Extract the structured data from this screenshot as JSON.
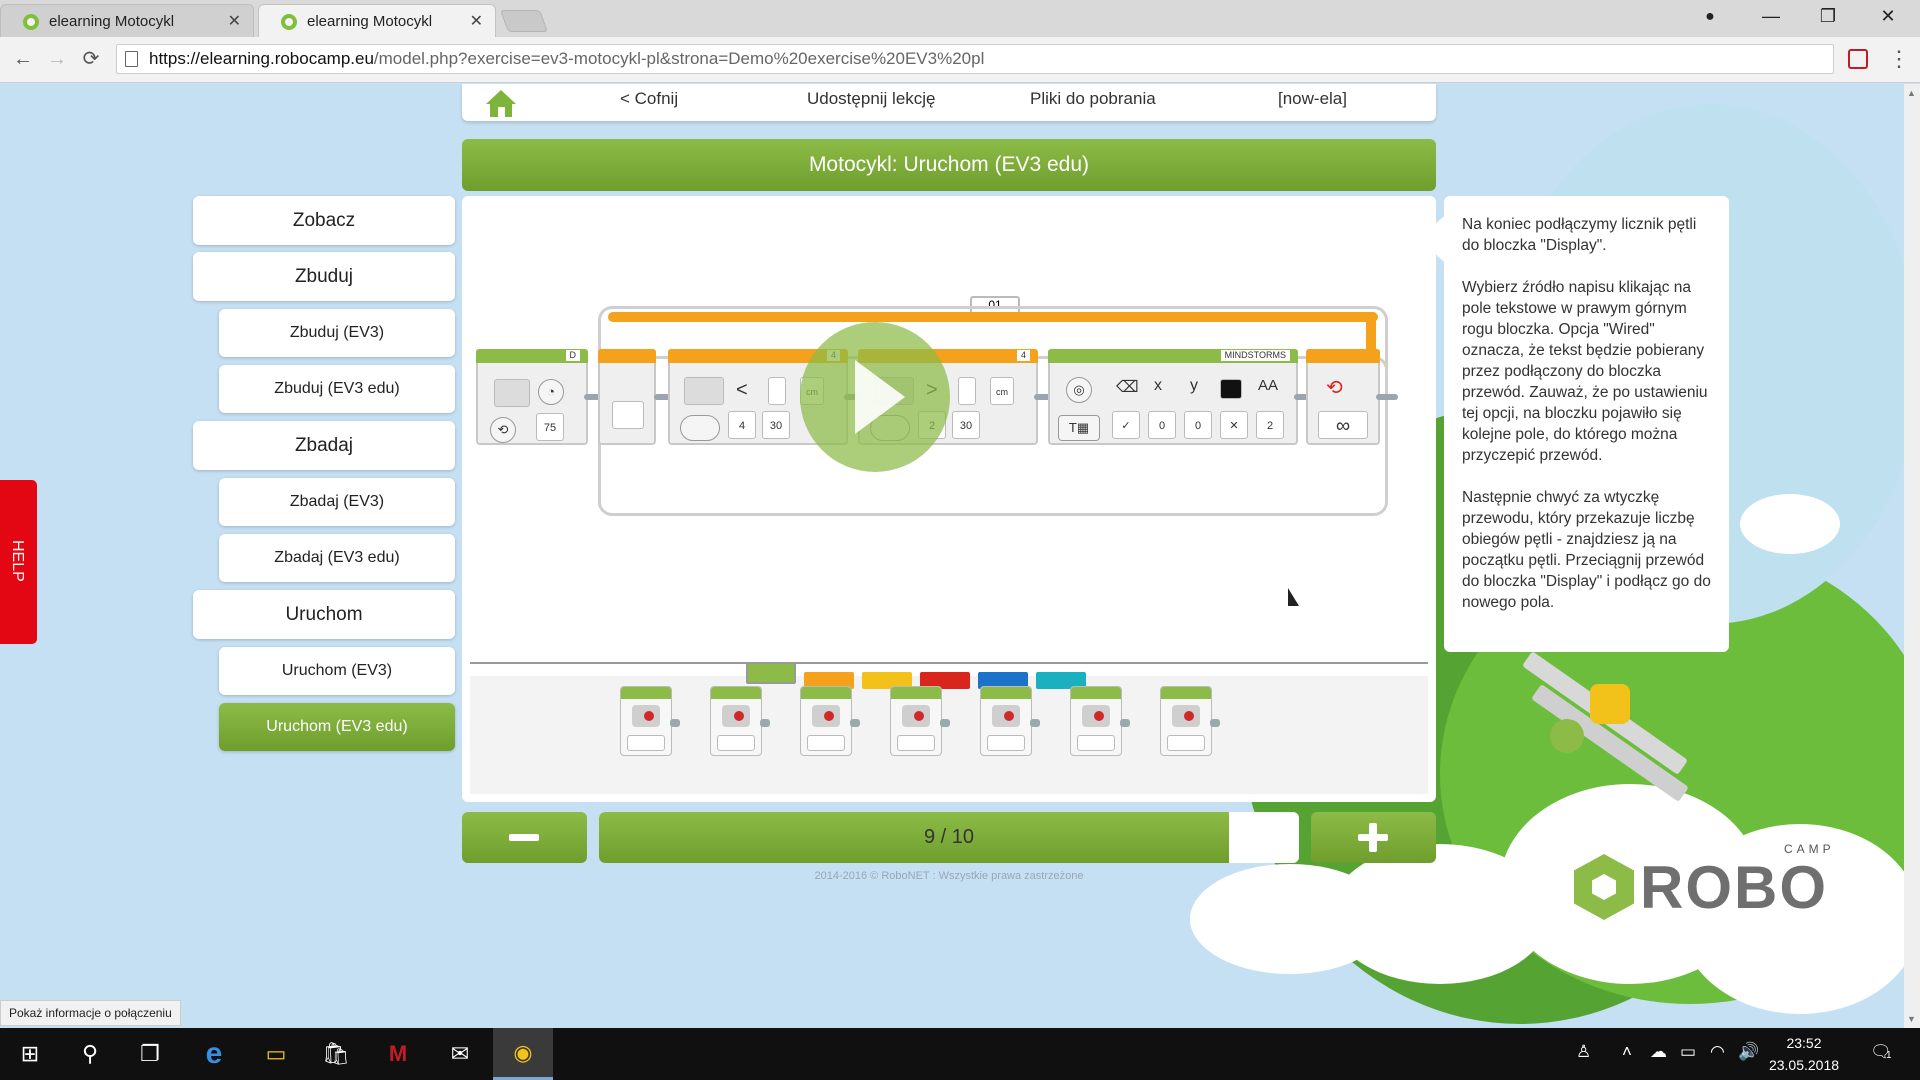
{
  "browser": {
    "tabs": [
      {
        "title": "elearning Motocykl",
        "active": false
      },
      {
        "title": "elearning Motocykl",
        "active": true
      }
    ],
    "close_glyph": "✕",
    "window_controls": {
      "account": "●",
      "minimize": "—",
      "restore": "❐",
      "close": "✕"
    },
    "nav": {
      "back": "←",
      "forward": "→",
      "reload": "⟳"
    },
    "url_host": "https://elearning.robocamp.eu",
    "url_rest": "/model.php?exercise=ev3-motocykl-pl&strona=Demo%20exercise%20EV3%20pl",
    "menu": "⋮"
  },
  "topnav": {
    "back": "< Cofnij",
    "share": "Udostępnij lekcję",
    "downloads": "Pliki do pobrania",
    "user": "[now-ela]"
  },
  "lesson_title": "Motocykl: Uruchom (EV3 edu)",
  "sidebar": {
    "items": [
      {
        "label": "Zobacz",
        "level": "main",
        "active": false
      },
      {
        "label": "Zbuduj",
        "level": "main",
        "active": false
      },
      {
        "label": "Zbuduj (EV3)",
        "level": "sub",
        "active": false
      },
      {
        "label": "Zbuduj (EV3 edu)",
        "level": "sub",
        "active": false
      },
      {
        "label": "Zbadaj",
        "level": "main",
        "active": false
      },
      {
        "label": "Zbadaj (EV3)",
        "level": "sub",
        "active": false
      },
      {
        "label": "Zbadaj (EV3 edu)",
        "level": "sub",
        "active": false
      },
      {
        "label": "Uruchom",
        "level": "main",
        "active": false
      },
      {
        "label": "Uruchom (EV3)",
        "level": "sub",
        "active": false
      },
      {
        "label": "Uruchom (EV3 edu)",
        "level": "sub",
        "active": true
      }
    ]
  },
  "help_label": "HELP",
  "program": {
    "loop_counter": "01",
    "loop_port": "D",
    "motor_power": "75",
    "wait1_header": "4",
    "wait1_compare": "<",
    "wait1_threshold": "4",
    "wait1_value": "30",
    "wait2_header": "4",
    "wait2_compare": ">",
    "wait2_threshold": "2",
    "wait2_value": "30",
    "display_header": "MINDSTORMS",
    "display_params": [
      "0",
      "0",
      "2"
    ],
    "loop_end_symbol": "∞",
    "cm_label": "cm"
  },
  "palette": {
    "tab_colors": [
      "#8cbb47",
      "#f4a11c",
      "#f2c21b",
      "#d9261c",
      "#1a73c8",
      "#1ab0c0"
    ],
    "block_count": 7
  },
  "progress": {
    "label": "9 / 10",
    "current": 9,
    "total": 10
  },
  "copyright": "2014-2016 © RoboNET : Wszystkie prawa zastrzeżone",
  "info": {
    "paragraphs": [
      "Na koniec podłączymy licznik pętli do bloczka \"Display\".",
      "Wybierz źródło napisu klikając na pole tekstowe w prawym górnym rogu bloczka. Opcja \"Wired\" oznacza, że tekst będzie pobierany przez podłączony do bloczka przewód. Zauważ, że po ustawieniu tej opcji, na bloczku pojawiło się kolejne pole, do którego można przyczepić przewód.",
      "Następnie chwyć za wtyczkę przewodu, który przekazuje liczbę obiegów pętli - znajdziesz ją na początku pętli. Przeciągnij przewód do bloczka \"Display\" i podłącz go do nowego pola."
    ]
  },
  "logo": {
    "camp": "CAMP",
    "word": "ROBO"
  },
  "status_bubble": "Pokaż informacje o połączeniu",
  "taskbar": {
    "start": "⊞",
    "search": "⚲",
    "task_view": "❐",
    "edge": "e",
    "explorer": "▭",
    "store": "🛍",
    "mcafee": "M",
    "mail": "✉",
    "chrome": "◉",
    "tray": {
      "people": "♙",
      "chevron": "˄",
      "cloud": "☁",
      "battery": "▭",
      "wifi": "◠",
      "volume": "🔊",
      "notifications": "🗨",
      "notif_count": "1"
    },
    "time": "23:52",
    "date": "23.05.2018"
  },
  "colors": {
    "accent": "#8cbb47",
    "accent_dark": "#6f9e2d",
    "help": "#e30613"
  }
}
